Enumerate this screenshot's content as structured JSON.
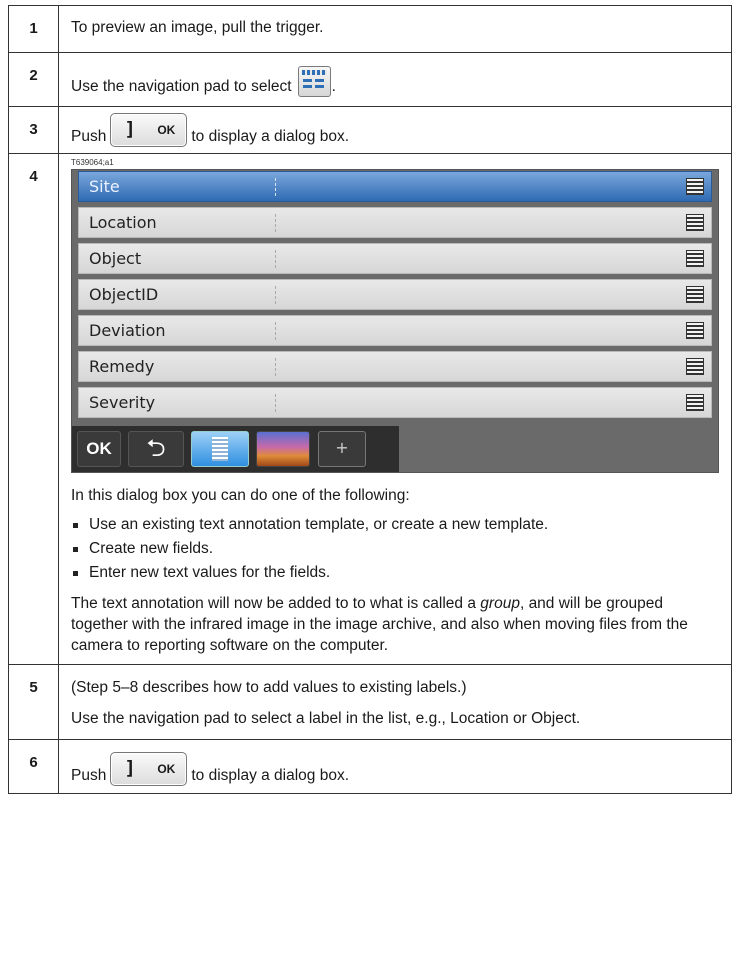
{
  "steps": {
    "s1": {
      "num": "1",
      "text": "To preview an image, pull the trigger."
    },
    "s2": {
      "num": "2",
      "text_before": "Use the navigation pad to select",
      "text_after": "."
    },
    "s3": {
      "num": "3",
      "push": "Push",
      "key_ok": "OK",
      "text_after": "to display a dialog box."
    },
    "s4": {
      "num": "4",
      "figure_id": "T639064;a1",
      "dialog": {
        "rows": [
          "Site",
          "Location",
          "Object",
          "ObjectID",
          "Deviation",
          "Remedy",
          "Severity"
        ],
        "selected_row": "Site",
        "toolbar": {
          "ok": "OK",
          "back": "⮌",
          "plus": "+"
        }
      },
      "intro": "In this dialog box you can do one of the following:",
      "bullets": [
        "Use an existing text annotation template, or create a new template.",
        "Create new fields.",
        "Enter new text values for the fields."
      ],
      "para_before": "The text annotation will now be added to to what is called a ",
      "para_em": "group",
      "para_after": ", and will be grouped together with the infrared image in the image archive, and also when moving files from the camera to reporting software on the computer."
    },
    "s5": {
      "num": "5",
      "line1": "(Step 5–8 describes how to add values to existing labels.)",
      "line2": "Use the navigation pad to select a label in the list, e.g., Location or Object."
    },
    "s6": {
      "num": "6",
      "push": "Push",
      "key_ok": "OK",
      "text_after": "to display a dialog box."
    }
  },
  "colors": {
    "selected_row": "#2f6ab3",
    "toolbar_bg": "#2e2e2e",
    "dialog_bg": "#6a6a6a"
  },
  "icons": [
    "template-list-icon",
    "ok-key-icon",
    "menu-lines-icon",
    "back-arrow-icon",
    "text-doc-icon",
    "photo-icon",
    "plus-icon"
  ]
}
